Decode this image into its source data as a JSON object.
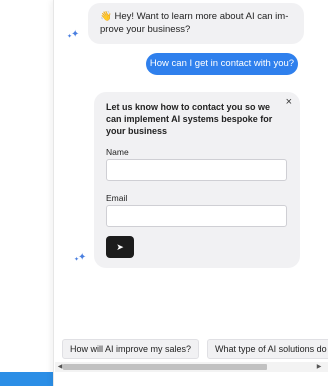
{
  "chat": {
    "greeting": {
      "emoji": "👋",
      "text": "Hey! Want to learn more about AI can im-prove your business?"
    },
    "user_message": "How can I get in contact with you?",
    "contact_form": {
      "heading": "Let us know how to contact you so we can implement AI systems bespoke for your business",
      "close_glyph": "×",
      "name_label": "Name",
      "name_value": "",
      "email_label": "Email",
      "email_value": "",
      "send_glyph": "➤"
    }
  },
  "suggestions": [
    "How will AI improve my sales?",
    "What type of AI solutions do"
  ],
  "scrollbar": {
    "left_arrow": "◀",
    "right_arrow": "▶"
  },
  "colors": {
    "accent": "#2f80ed",
    "bubble_bg": "#f1f1f3",
    "send_button": "#1c1c1c",
    "sparkle": "#4a7fe0"
  }
}
